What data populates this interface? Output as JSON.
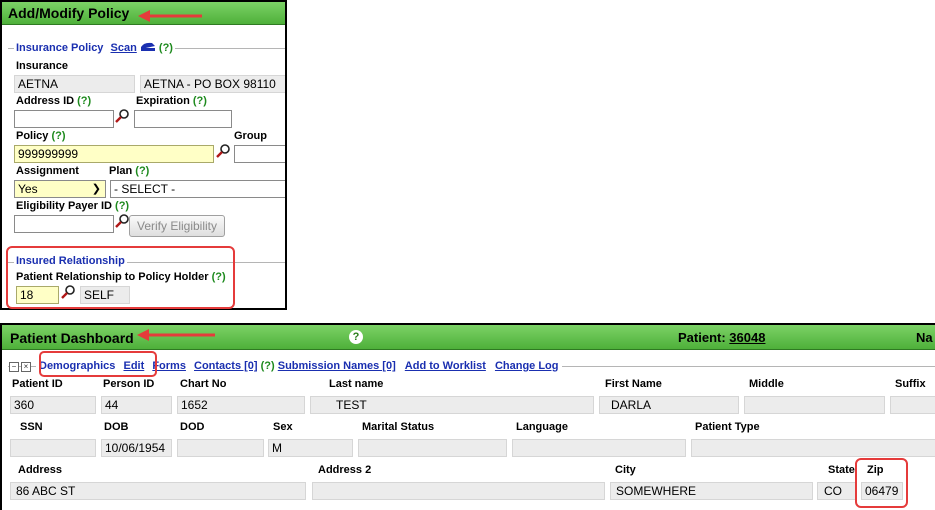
{
  "policy_panel": {
    "title": "Add/Modify Policy",
    "insurance_policy": {
      "legend": "Insurance Policy",
      "scan_label": "Scan",
      "help": "(?)"
    },
    "insurance_label": "Insurance",
    "insurance_code": "AETNA",
    "insurance_name": "AETNA - PO BOX 98110",
    "address_id_label": "Address ID",
    "address_id_help": "(?)",
    "address_id_value": "",
    "expiration_label": "Expiration",
    "expiration_help": "(?)",
    "expiration_value": "",
    "policy_label": "Policy",
    "policy_help": "(?)",
    "policy_value": "999999999",
    "group_label": "Group",
    "group_value": "",
    "assignment_label": "Assignment",
    "assignment_value": "Yes",
    "plan_label": "Plan",
    "plan_help": "(?)",
    "plan_value": "- SELECT -",
    "eligibility_label": "Eligibility Payer ID",
    "eligibility_help": "(?)",
    "eligibility_value": "",
    "verify_button": "Verify Eligibility",
    "insured_relationship": {
      "legend": "Insured Relationship",
      "label": "Patient Relationship to Policy Holder",
      "help": "(?)",
      "code": "18",
      "desc": "SELF"
    }
  },
  "dashboard": {
    "title": "Patient Dashboard",
    "help": "?",
    "patient_label": "Patient:",
    "patient_id": "36048",
    "name_prefix": "Na",
    "tabs": {
      "demographics": "Demographics",
      "edit": "Edit",
      "forms": "Forms",
      "contacts": "Contacts [0]",
      "contacts_help": "(?)",
      "submission": "Submission Names [0]",
      "worklist": "Add to Worklist",
      "changelog": "Change Log"
    },
    "row1": {
      "labels": {
        "patient_id": "Patient ID",
        "person_id": "Person ID",
        "chart_no": "Chart No",
        "last_name": "Last name",
        "first_name": "First Name",
        "middle": "Middle",
        "suffix": "Suffix"
      },
      "values": {
        "patient_id": "360",
        "person_id": "44",
        "chart_no": "1652",
        "last_name": "TEST",
        "first_name": "DARLA",
        "middle": "",
        "suffix": ""
      }
    },
    "row2": {
      "labels": {
        "ssn": "SSN",
        "dob": "DOB",
        "dod": "DOD",
        "sex": "Sex",
        "marital": "Marital Status",
        "language": "Language",
        "patient_type": "Patient Type"
      },
      "values": {
        "ssn": "",
        "dob": "10/06/1954",
        "dod": "",
        "sex": "M",
        "marital": "",
        "language": "",
        "patient_type": ""
      }
    },
    "row3": {
      "labels": {
        "address": "Address",
        "address2": "Address 2",
        "city": "City",
        "state": "State",
        "zip": "Zip"
      },
      "values": {
        "address": "86 ABC ST",
        "address2": "",
        "city": "SOMEWHERE",
        "state": "CO",
        "zip": "06479"
      }
    }
  },
  "colors": {
    "header_green": "#4eb03a",
    "highlight_red": "#e53b3b",
    "link_blue": "#1a2fb0",
    "help_green": "#1d8a1d"
  }
}
